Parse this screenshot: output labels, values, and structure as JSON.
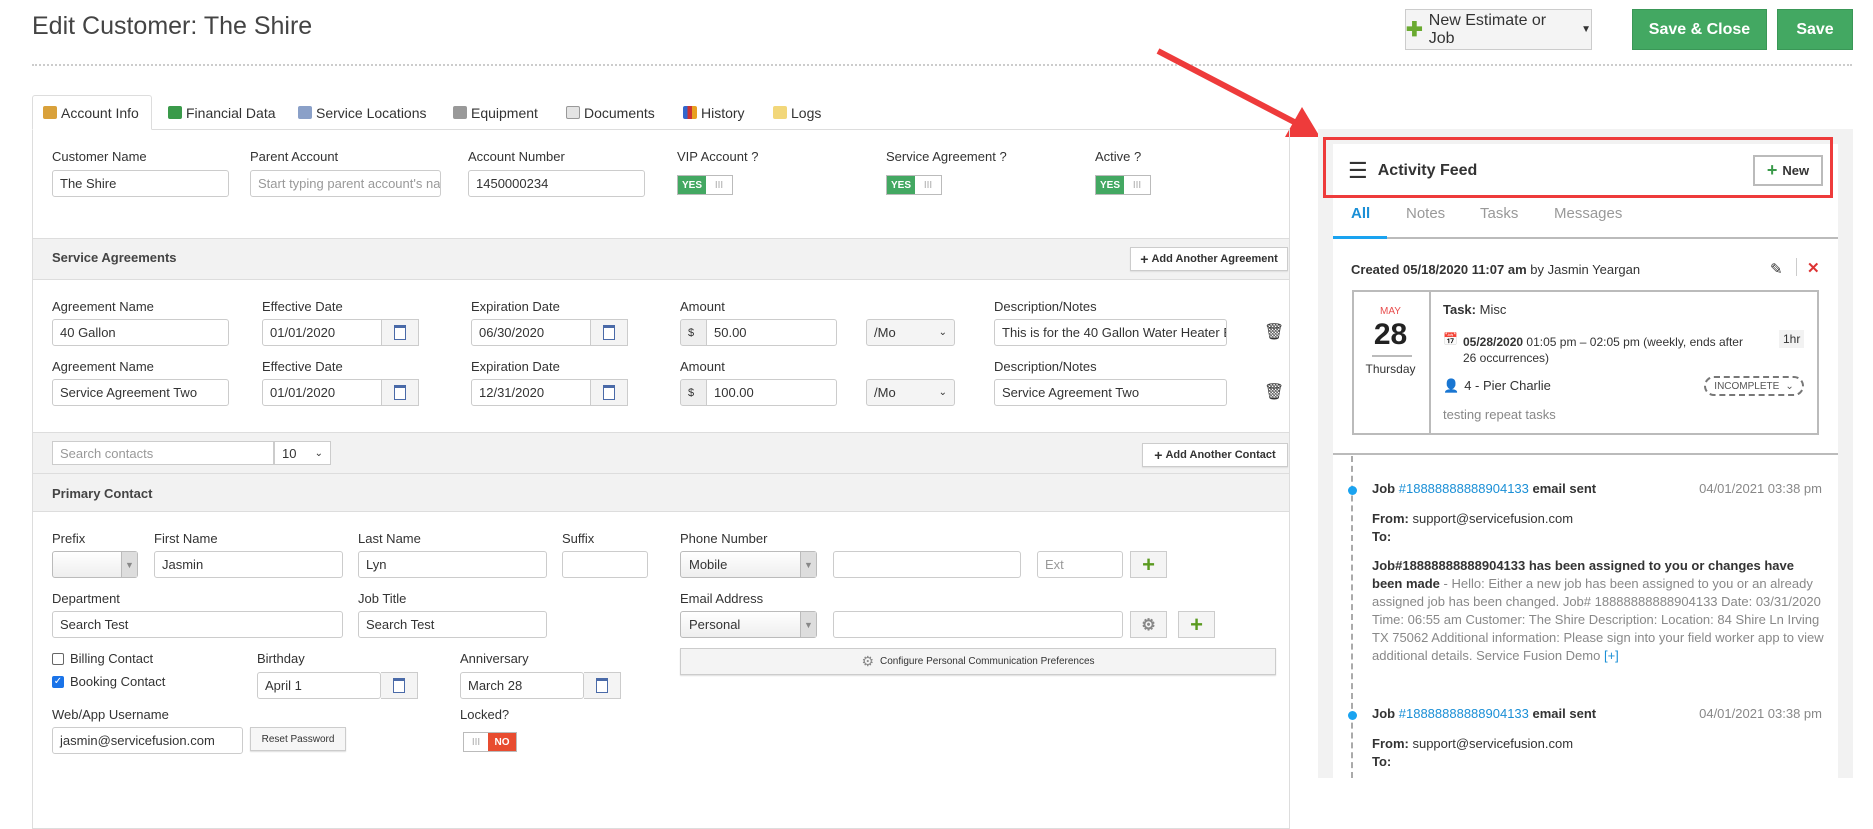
{
  "header": {
    "title": "Edit Customer: The Shire",
    "new_estimate_label": "New Estimate or Job",
    "save_close_label": "Save & Close",
    "save_label": "Save"
  },
  "tabs": [
    {
      "label": "Account Info",
      "icon": "users-icon"
    },
    {
      "label": "Financial Data",
      "icon": "money-icon"
    },
    {
      "label": "Service Locations",
      "icon": "location-doc-icon"
    },
    {
      "label": "Equipment",
      "icon": "equipment-icon"
    },
    {
      "label": "Documents",
      "icon": "document-icon"
    },
    {
      "label": "History",
      "icon": "chart-icon"
    },
    {
      "label": "Logs",
      "icon": "envelope-icon"
    }
  ],
  "account": {
    "customer_name_label": "Customer Name",
    "customer_name": "The Shire",
    "parent_label": "Parent Account",
    "parent_placeholder": "Start typing parent account's nam",
    "account_number_label": "Account Number",
    "account_number": "1450000234",
    "vip_label": "VIP Account ?",
    "service_agreement_label": "Service Agreement ?",
    "active_label": "Active ?",
    "yes": "YES",
    "toggle_grip": "III"
  },
  "agreements": {
    "title": "Service Agreements",
    "add_label": "Add Another Agreement",
    "labels": {
      "name": "Agreement Name",
      "effective": "Effective Date",
      "expiration": "Expiration Date",
      "amount": "Amount",
      "desc": "Description/Notes"
    },
    "currency": "$",
    "rows": [
      {
        "name": "40 Gallon",
        "effective": "01/01/2020",
        "expiration": "06/30/2020",
        "amount": "50.00",
        "period": "/Mo",
        "desc": "This is for the 40 Gallon Water Heater Eq"
      },
      {
        "name": "Service Agreement Two",
        "effective": "01/01/2020",
        "expiration": "12/31/2020",
        "amount": "100.00",
        "period": "/Mo",
        "desc": "Service Agreement Two"
      }
    ]
  },
  "contacts": {
    "search_placeholder": "Search contacts",
    "page_size": "10",
    "add_label": "Add Another Contact"
  },
  "primary": {
    "title": "Primary Contact",
    "prefix_label": "Prefix",
    "first_label": "First Name",
    "first": "Jasmin",
    "last_label": "Last Name",
    "last": "Lyn",
    "suffix_label": "Suffix",
    "phone_label": "Phone Number",
    "phone_type": "Mobile",
    "ext_placeholder": "Ext",
    "dept_label": "Department",
    "dept": "Search Test",
    "job_label": "Job Title",
    "job": "Search Test",
    "email_label": "Email Address",
    "email_type": "Personal",
    "billing": "Billing Contact",
    "booking": "Booking Contact",
    "birthday_label": "Birthday",
    "birthday": "April 1",
    "anniv_label": "Anniversary",
    "anniv": "March 28",
    "configure": "Configure Personal Communication Preferences",
    "web_label": "Web/App Username",
    "web": "jasmin@servicefusion.com",
    "reset": "Reset Password",
    "locked_label": "Locked?",
    "no": "NO",
    "billing_checked": false,
    "booking_checked": true
  },
  "feed": {
    "title": "Activity Feed",
    "new_label": "New",
    "tabs": [
      "All",
      "Notes",
      "Tasks",
      "Messages"
    ],
    "active_tab": "All",
    "created_prefix": "Created 05/18/2020 11:07 am",
    "created_by": "by Jasmin Yeargan",
    "task": {
      "month": "MAY",
      "day": "28",
      "weekday": "Thursday",
      "label": "Task:",
      "name": "Misc",
      "date": "05/28/2020",
      "time": "01:05 pm – 02:05 pm (weekly, ends after",
      "time2": "26 occurrences)",
      "duration": "1hr",
      "assignee": "4 - Pier Charlie",
      "status": "INCOMPLETE",
      "note": "testing repeat tasks"
    },
    "items": [
      {
        "job": "Job",
        "num": "#18888888888904133",
        "action": "email sent",
        "time": "04/01/2021 03:38 pm",
        "from_label": "From:",
        "from": "support@servicefusion.com",
        "to_label": "To:",
        "subject": "Job#18888888888904133 has been assigned to you or changes have been made",
        "body": " - Hello:   Either a new job has been assigned to you or an already assigned job has been changed.   Job# 18888888888904133 Date: 03/31/2020 Time: 06:55 am Customer: The Shire Description: Location: 84 Shire Ln  Irving TX 75062  Additional information:    Please sign into your field worker app to view additional details.   Service Fusion Demo ",
        "more": "[+]"
      },
      {
        "job": "Job",
        "num": "#18888888888904133",
        "action": "email sent",
        "time": "04/01/2021 03:38 pm",
        "from_label": "From:",
        "from": "support@servicefusion.com",
        "to_label": "To:"
      }
    ]
  },
  "colors": {
    "green": "#43a862",
    "blue": "#1a8fd6",
    "red_highlight": "#ee3b3b"
  }
}
